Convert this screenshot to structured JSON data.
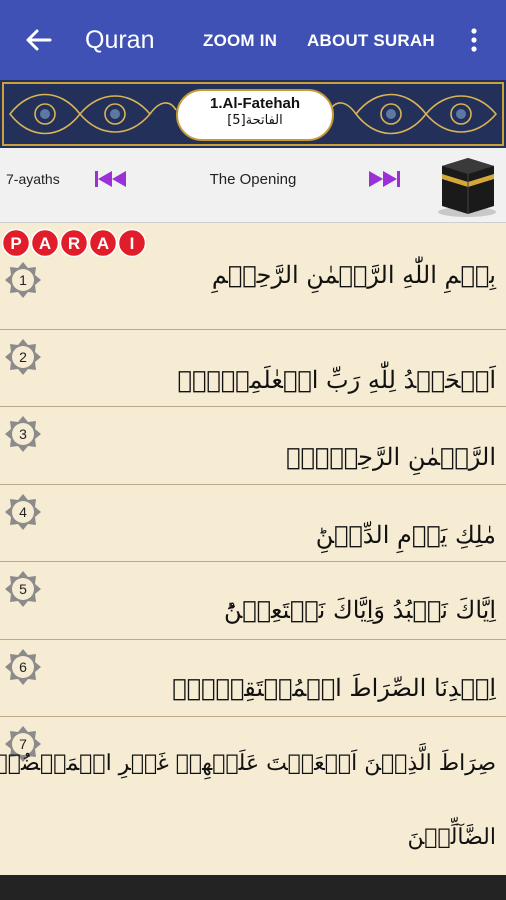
{
  "appbar": {
    "title": "Quran",
    "zoom_in_label": "ZOOM IN",
    "about_surah_label": "ABOUT SURAH",
    "color": "#3f51b5"
  },
  "banner": {
    "title": "1.Al-Fatehah",
    "subtitle": "[5]الفاتحة"
  },
  "infobar": {
    "ayahs_count": "7-ayaths",
    "surah_name_en": "The Opening"
  },
  "tag": {
    "letters": [
      "P",
      "A",
      "R",
      "A",
      "I"
    ]
  },
  "verses": [
    {
      "number": "1",
      "text": "بِسۡمِ اللّٰهِ الرَّحۡمٰنِ الرَّحِيۡمِ"
    },
    {
      "number": "2",
      "text": "اَلۡحَمۡدُ لِلّٰهِ رَبِّ الۡعٰلَمِيۡنَۙ"
    },
    {
      "number": "3",
      "text": "الرَّحۡمٰنِ الرَّحِيۡمِۙ"
    },
    {
      "number": "4",
      "text": "مٰلِكِ يَوۡمِ الدِّيۡنِؕ"
    },
    {
      "number": "5",
      "text": "اِيَّاكَ نَعۡبُدُ وَاِيَّاكَ نَسۡتَعِيۡنُؕ"
    },
    {
      "number": "6",
      "text": "اِهۡدِنَا الصِّرَاطَ الۡمُسۡتَقِيۡمَۙ"
    },
    {
      "number": "7",
      "text": "صِرَاطَ الَّذِيۡنَ اَنۡعَمۡتَ عَلَيۡهِمۡ غَيۡرِ الۡمَغۡضُوۡبِ عَلَيۡهِمۡ وَلَا",
      "text2": "الضَّآلِّيۡنَ"
    }
  ]
}
